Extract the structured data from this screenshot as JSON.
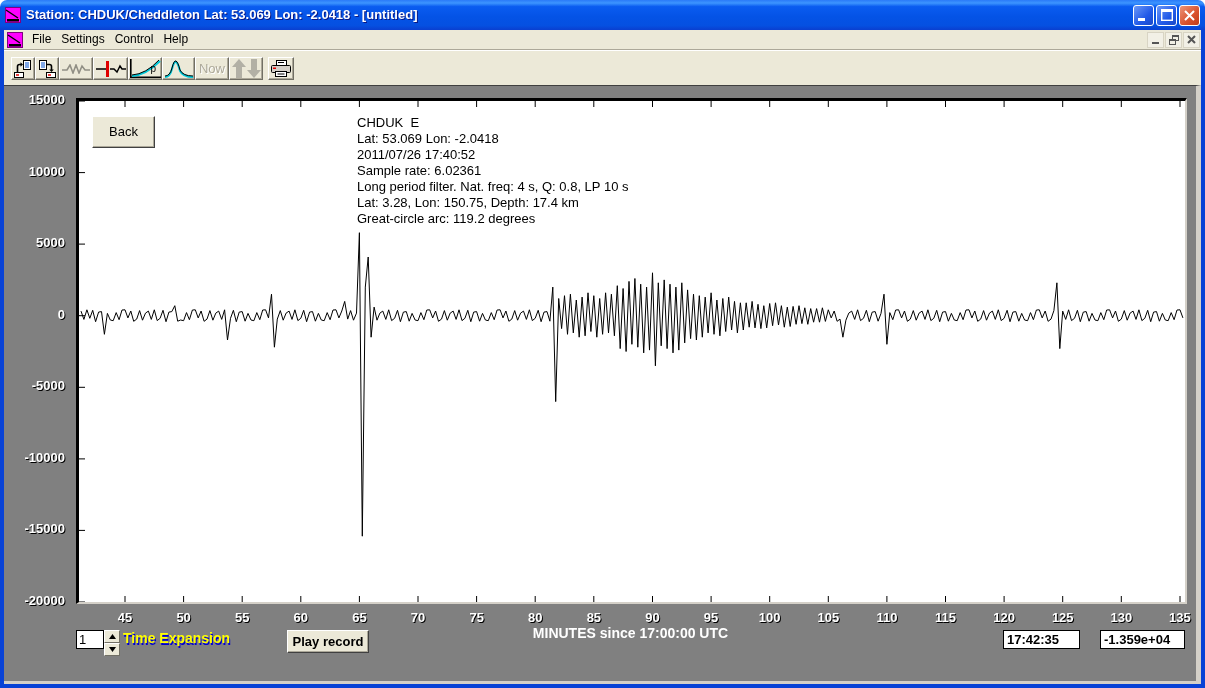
{
  "window": {
    "title": "Station: CHDUK/Cheddleton Lat: 53.069 Lon: -2.0418 - [untitled]"
  },
  "menu": [
    "File",
    "Settings",
    "Control",
    "Help"
  ],
  "toolbar": [
    [
      {
        "disabled": false
      },
      {
        "disabled": false
      },
      {
        "disabled": true
      },
      {
        "disabled": false
      },
      {
        "label": "p",
        "disabled": false
      },
      {
        "disabled": false
      },
      {
        "label": "Now",
        "disabled": true
      },
      {
        "disabled": true
      }
    ],
    [
      {
        "disabled": false
      }
    ]
  ],
  "plot": {
    "back_button": "Back",
    "info_lines": [
      "CHDUK  E",
      "Lat: 53.069 Lon: -2.0418",
      "2011/07/26 17:40:52",
      "Sample rate: 6.02361",
      "Long period filter. Nat. freq: 4 s, Q: 0.8, LP 10 s",
      "Lat: 3.28, Lon: 150.75, Depth: 17.4 km",
      "Great-circle arc: 119.2 degrees"
    ],
    "chart_data": {
      "type": "line",
      "xlabel": "MINUTES since 17:00:00 UTC",
      "xlim": [
        41.08,
        135.43
      ],
      "ylim": [
        -20000,
        15000
      ],
      "xticks": [
        45,
        50,
        55,
        60,
        65,
        70,
        75,
        80,
        85,
        90,
        95,
        100,
        105,
        110,
        115,
        120,
        125,
        130,
        135
      ],
      "yticks": [
        -20000,
        -15000,
        -10000,
        -5000,
        0,
        5000,
        10000,
        15000
      ],
      "x": [
        41.25,
        41.5,
        41.75,
        42,
        42.25,
        42.5,
        42.75,
        43,
        43.25,
        43.5,
        43.75,
        44,
        44.25,
        44.5,
        44.75,
        45,
        45.25,
        45.5,
        45.75,
        46,
        46.25,
        46.5,
        46.75,
        47,
        47.25,
        47.5,
        47.75,
        48,
        48.25,
        48.5,
        48.75,
        49,
        49.25,
        49.5,
        49.75,
        50,
        50.25,
        50.5,
        50.75,
        51,
        51.25,
        51.5,
        51.75,
        52,
        52.25,
        52.5,
        52.75,
        53,
        53.25,
        53.5,
        53.75,
        54,
        54.25,
        54.5,
        54.75,
        55,
        55.25,
        55.5,
        55.75,
        56,
        56.25,
        56.5,
        56.75,
        57,
        57.25,
        57.5,
        57.75,
        58,
        58.25,
        58.5,
        58.75,
        59,
        59.25,
        59.5,
        59.75,
        60,
        60.25,
        60.5,
        60.75,
        61,
        61.25,
        61.5,
        61.75,
        62,
        62.25,
        62.5,
        62.75,
        63,
        63.25,
        63.5,
        63.75,
        64,
        64.25,
        64.5,
        64.75,
        65,
        65.25,
        65.5,
        65.75,
        66,
        66.25,
        66.5,
        66.75,
        67,
        67.25,
        67.5,
        67.75,
        68,
        68.25,
        68.5,
        68.75,
        69,
        69.25,
        69.5,
        69.75,
        70,
        70.25,
        70.5,
        70.75,
        71,
        71.25,
        71.5,
        71.75,
        72,
        72.25,
        72.5,
        72.75,
        73,
        73.25,
        73.5,
        73.75,
        74,
        74.25,
        74.5,
        74.75,
        75,
        75.25,
        75.5,
        75.75,
        76,
        76.25,
        76.5,
        76.75,
        77,
        77.25,
        77.5,
        77.75,
        78,
        78.25,
        78.5,
        78.75,
        79,
        79.25,
        79.5,
        79.75,
        80,
        80.25,
        80.5,
        80.75,
        81,
        81.25,
        81.5,
        81.75,
        82,
        82.25,
        82.5,
        82.75,
        83,
        83.25,
        83.5,
        83.75,
        84,
        84.25,
        84.5,
        84.75,
        85,
        85.25,
        85.5,
        85.75,
        86,
        86.25,
        86.5,
        86.75,
        87,
        87.25,
        87.5,
        87.75,
        88,
        88.25,
        88.5,
        88.75,
        89,
        89.25,
        89.5,
        89.75,
        90,
        90.25,
        90.5,
        90.75,
        91,
        91.25,
        91.5,
        91.75,
        92,
        92.25,
        92.5,
        92.75,
        93,
        93.25,
        93.5,
        93.75,
        94,
        94.25,
        94.5,
        94.75,
        95,
        95.25,
        95.5,
        95.75,
        96,
        96.25,
        96.5,
        96.75,
        97,
        97.25,
        97.5,
        97.75,
        98,
        98.25,
        98.5,
        98.75,
        99,
        99.25,
        99.5,
        99.75,
        100,
        100.25,
        100.5,
        100.75,
        101,
        101.25,
        101.5,
        101.75,
        102,
        102.25,
        102.5,
        102.75,
        103,
        103.25,
        103.5,
        103.75,
        104,
        104.25,
        104.5,
        104.75,
        105,
        105.25,
        105.5,
        105.75,
        106,
        106.25,
        106.5,
        106.75,
        107,
        107.25,
        107.5,
        107.75,
        108,
        108.25,
        108.5,
        108.75,
        109,
        109.25,
        109.5,
        109.75,
        110,
        110.25,
        110.5,
        110.75,
        111,
        111.25,
        111.5,
        111.75,
        112,
        112.25,
        112.5,
        112.75,
        113,
        113.25,
        113.5,
        113.75,
        114,
        114.25,
        114.5,
        114.75,
        115,
        115.25,
        115.5,
        115.75,
        116,
        116.25,
        116.5,
        116.75,
        117,
        117.25,
        117.5,
        117.75,
        118,
        118.25,
        118.5,
        118.75,
        119,
        119.25,
        119.5,
        119.75,
        120,
        120.25,
        120.5,
        120.75,
        121,
        121.25,
        121.5,
        121.75,
        122,
        122.25,
        122.5,
        122.75,
        123,
        123.25,
        123.5,
        123.75,
        124,
        124.25,
        124.5,
        124.75,
        125,
        125.25,
        125.5,
        125.75,
        126,
        126.25,
        126.5,
        126.75,
        127,
        127.25,
        127.5,
        127.75,
        128,
        128.25,
        128.5,
        128.75,
        129,
        129.25,
        129.5,
        129.75,
        130,
        130.25,
        130.5,
        130.75,
        131,
        131.25,
        131.5,
        131.75,
        132,
        132.25,
        132.5,
        132.75,
        133,
        133.25,
        133.5,
        133.75,
        134,
        134.25,
        134.5,
        134.75,
        135,
        135.25
      ],
      "series": [
        {
          "color": "#000000",
          "values": [
            320,
            -260,
            410,
            -180,
            380,
            -420,
            250,
            290,
            -1300,
            160,
            -300,
            -350,
            220,
            -280,
            400,
            410,
            -150,
            330,
            -390,
            -240,
            360,
            -310,
            180,
            320,
            -260,
            410,
            -340,
            -180,
            380,
            -420,
            250,
            290,
            700,
            -380,
            -300,
            -350,
            220,
            -280,
            400,
            410,
            -150,
            330,
            -390,
            -240,
            360,
            -310,
            180,
            320,
            -260,
            410,
            -1700,
            -180,
            380,
            -420,
            250,
            290,
            -380,
            160,
            -300,
            -350,
            220,
            -280,
            400,
            410,
            -150,
            1500,
            -2200,
            -240,
            360,
            -310,
            180,
            320,
            -260,
            410,
            -340,
            -180,
            380,
            -420,
            250,
            290,
            -380,
            160,
            -300,
            -350,
            220,
            -280,
            400,
            410,
            -150,
            330,
            1000,
            -240,
            360,
            -310,
            180,
            5800,
            -15400,
            2000,
            4100,
            -1500,
            600,
            -310,
            180,
            320,
            -260,
            410,
            -340,
            -180,
            380,
            -420,
            250,
            290,
            -380,
            160,
            -300,
            -350,
            220,
            -280,
            400,
            410,
            -150,
            330,
            -390,
            -240,
            360,
            -310,
            180,
            320,
            -260,
            410,
            -340,
            -180,
            380,
            -420,
            250,
            290,
            -380,
            160,
            -300,
            -350,
            220,
            -280,
            400,
            410,
            -150,
            330,
            -390,
            -240,
            360,
            -310,
            180,
            320,
            -260,
            410,
            -340,
            -180,
            380,
            -420,
            250,
            290,
            -380,
            2000,
            -6000,
            1200,
            -900,
            1400,
            -1300,
            1500,
            -1200,
            1100,
            -1500,
            1300,
            -1400,
            1600,
            -1100,
            1400,
            -1500,
            1200,
            -1300,
            1600,
            -1200,
            1500,
            -1400,
            2100,
            -2300,
            1900,
            -2500,
            2400,
            -2000,
            2600,
            -2200,
            2200,
            -2600,
            2000,
            -2400,
            3000,
            -3500,
            2300,
            -2100,
            2500,
            -2300,
            2200,
            -2600,
            2000,
            -2400,
            2300,
            -1900,
            1800,
            -1600,
            1500,
            -1700,
            1400,
            -1500,
            1300,
            -1200,
            1600,
            -1300,
            1100,
            -1400,
            1200,
            -1100,
            1300,
            -1000,
            1000,
            -1200,
            900,
            -1000,
            900,
            -800,
            1000,
            -850,
            800,
            -900,
            700,
            -850,
            850,
            -700,
            900,
            -650,
            700,
            -800,
            600,
            -750,
            650,
            -600,
            700,
            -550,
            550,
            -600,
            500,
            -450,
            500,
            -450,
            550,
            -400,
            410,
            -150,
            330,
            -390,
            -240,
            -1500,
            -310,
            180,
            320,
            -260,
            410,
            -340,
            -180,
            380,
            -420,
            250,
            290,
            -380,
            160,
            1500,
            -2000,
            220,
            -280,
            400,
            410,
            -150,
            330,
            -390,
            -240,
            360,
            -310,
            180,
            320,
            -260,
            410,
            -340,
            -180,
            380,
            -420,
            250,
            290,
            -380,
            160,
            -300,
            -350,
            220,
            -280,
            400,
            410,
            -150,
            330,
            -390,
            -240,
            360,
            -310,
            180,
            320,
            -260,
            410,
            -340,
            -180,
            380,
            -420,
            250,
            290,
            -380,
            160,
            -300,
            -350,
            220,
            -280,
            400,
            410,
            -150,
            330,
            -390,
            -240,
            360,
            2300,
            -2300,
            320,
            -260,
            410,
            -340,
            -180,
            380,
            -420,
            250,
            290,
            -380,
            160,
            -300,
            -350,
            220,
            -280,
            400,
            410,
            -150,
            330,
            -390,
            -240,
            360,
            -310,
            180,
            320,
            -260,
            410,
            -340,
            -180,
            380,
            -420,
            250,
            290,
            -380,
            160,
            -300,
            -350,
            220,
            -280,
            400,
            410,
            -150
          ]
        }
      ]
    }
  },
  "controls": {
    "time_expansion": {
      "value": "1",
      "label": "Time Expansion"
    },
    "play_button": "Play record",
    "time_readout": "17:42:35",
    "value_readout": "-1.359e+04"
  }
}
